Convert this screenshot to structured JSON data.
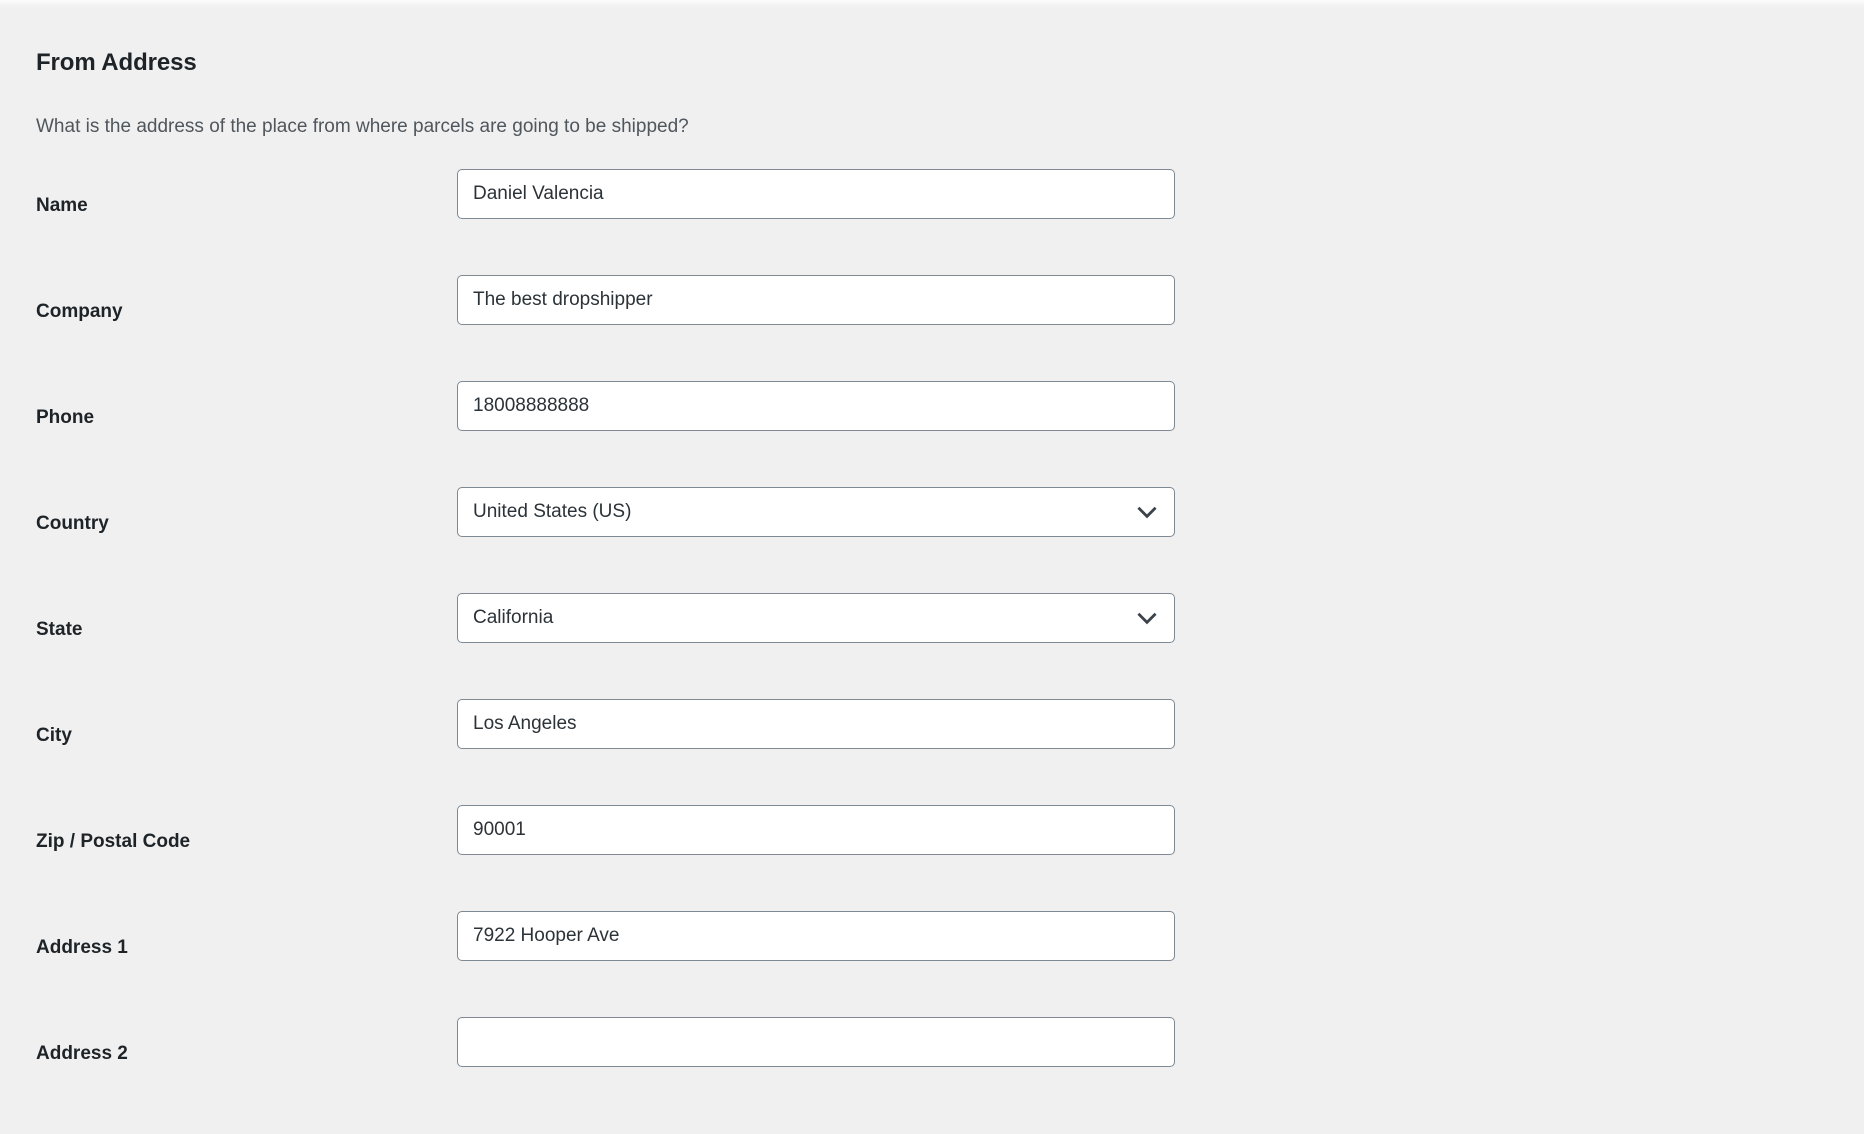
{
  "section": {
    "title": "From Address",
    "description": "What is the address of the place from where parcels are going to be shipped?"
  },
  "fields": [
    {
      "label": "Name",
      "type": "text",
      "value": "Daniel Valencia",
      "placeholder": ""
    },
    {
      "label": "Company",
      "type": "text",
      "value": "The best dropshipper",
      "placeholder": ""
    },
    {
      "label": "Phone",
      "type": "text",
      "value": "18008888888",
      "placeholder": ""
    },
    {
      "label": "Country",
      "type": "select",
      "value": "United States (US)",
      "icon": "chevron-down-icon"
    },
    {
      "label": "State",
      "type": "select",
      "value": "California",
      "icon": "chevron-down-icon"
    },
    {
      "label": "City",
      "type": "text",
      "value": "Los Angeles",
      "placeholder": ""
    },
    {
      "label": "Zip / Postal Code",
      "type": "text",
      "value": "90001",
      "placeholder": ""
    },
    {
      "label": "Address 1",
      "type": "text",
      "value": "7922 Hooper Ave",
      "placeholder": ""
    },
    {
      "label": "Address 2",
      "type": "text",
      "value": "",
      "placeholder": ""
    }
  ],
  "colors": {
    "page_background": "#f0f0f1",
    "field_background": "#ffffff",
    "field_border": "#7e8993",
    "label_text": "#1d2327",
    "value_text": "#2c3338",
    "description_text": "#4f565c"
  }
}
